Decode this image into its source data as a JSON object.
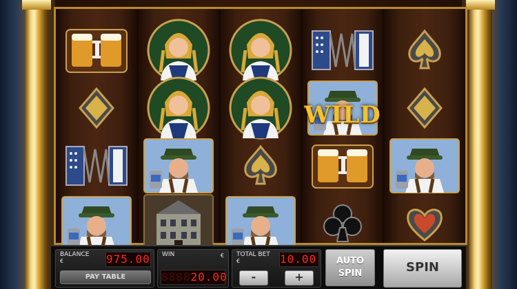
{
  "reels": [
    [
      "beer-mugs",
      "diamond-suit",
      "accordion",
      "bavarian-man"
    ],
    [
      "bavarian-woman",
      "bavarian-woman",
      "bavarian-man",
      "town-hall"
    ],
    [
      "bavarian-woman",
      "bavarian-woman",
      "spade-suit",
      "bavarian-man"
    ],
    [
      "accordion",
      "bavarian-man",
      "beer-mugs",
      "club-suit"
    ],
    [
      "spade-suit",
      "diamond-suit",
      "bavarian-man",
      "heart-suit"
    ]
  ],
  "wild": {
    "label": "WILD"
  },
  "controls": {
    "balance": {
      "label": "BALANCE",
      "currency": "€",
      "value": "975.00"
    },
    "paytable_label": "PAY TABLE",
    "win": {
      "label": "WIN",
      "currency": "€",
      "ghost": "8888",
      "value": "20.00"
    },
    "total_bet": {
      "label": "TOTAL BET",
      "currency": "€",
      "value": "10.00"
    },
    "minus_label": "-",
    "plus_label": "+",
    "auto_line1": "AUTO",
    "auto_line2": "SPIN",
    "spin_label": "SPIN"
  },
  "colors": {
    "led": "#ff2a1a",
    "frame_gold": "#b88a2e",
    "wild_gold": "#f2c230"
  }
}
